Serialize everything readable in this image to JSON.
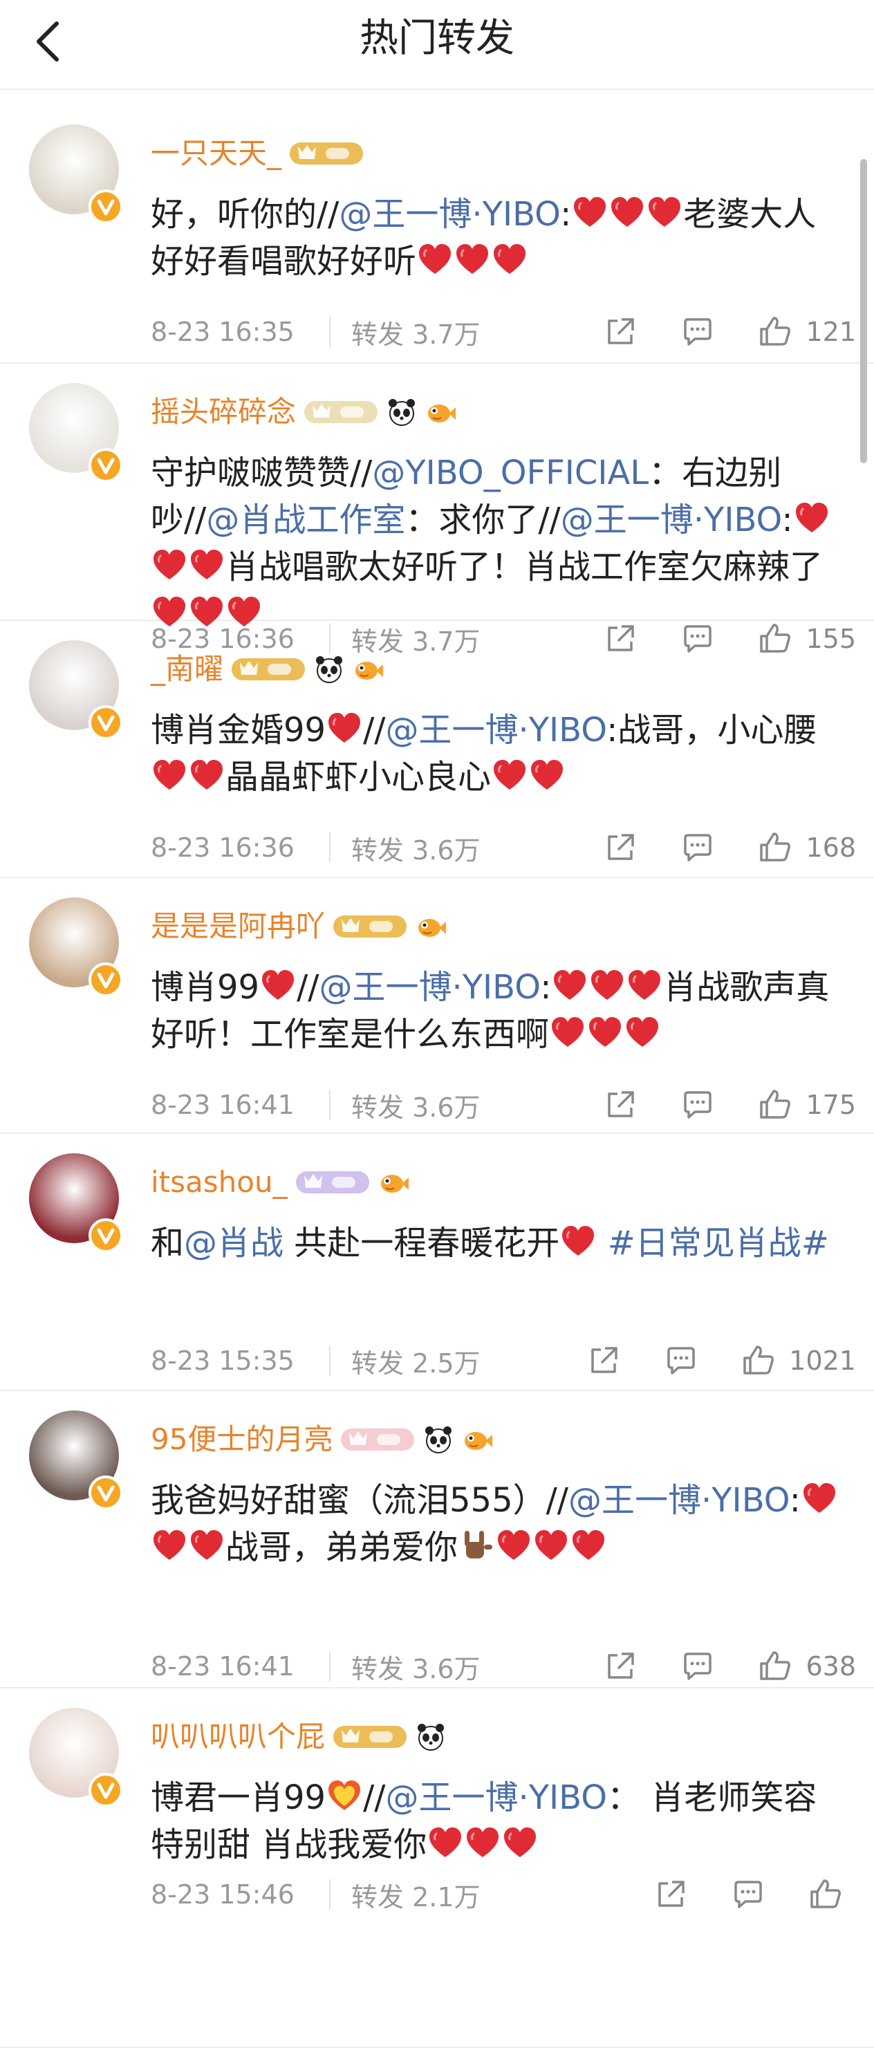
{
  "header": {
    "title": "热门转发"
  },
  "posts": [
    {
      "username": "一只天天_",
      "body": [
        {
          "t": "text",
          "v": "好，听你的//"
        },
        {
          "t": "mention",
          "v": "@王一博·YIBO"
        },
        {
          "t": "text",
          "v": ":"
        },
        {
          "t": "heart"
        },
        {
          "t": "heart"
        },
        {
          "t": "heart"
        },
        {
          "t": "text",
          "v": "老婆大人好好看唱歌好好听"
        },
        {
          "t": "heart"
        },
        {
          "t": "heart"
        },
        {
          "t": "heart"
        }
      ],
      "time": "8-23 16:35",
      "repost": "转发 3.7万",
      "likes": "121",
      "badge_color": "#e9b23a",
      "avatar_color": "#dcd6c8",
      "emojis": []
    },
    {
      "username": "摇头碎碎念",
      "body": [
        {
          "t": "text",
          "v": "守护啵啵赞赞//"
        },
        {
          "t": "mention",
          "v": "@YIBO_OFFICIAL"
        },
        {
          "t": "text",
          "v": "：右边别吵//"
        },
        {
          "t": "mention",
          "v": "@肖战工作室"
        },
        {
          "t": "text",
          "v": "：求你了//"
        },
        {
          "t": "mention",
          "v": "@王一博·YIBO"
        },
        {
          "t": "text",
          "v": ":"
        },
        {
          "t": "heart"
        },
        {
          "t": "heart"
        },
        {
          "t": "heart"
        },
        {
          "t": "text",
          "v": "肖战唱歌太好听了！肖战工作室欠麻辣了"
        },
        {
          "t": "heart"
        },
        {
          "t": "heart"
        },
        {
          "t": "heart"
        }
      ],
      "time": "8-23 16:36",
      "repost": "转发 3.7万",
      "likes": "155",
      "badge_color": "#e8d9a8",
      "avatar_color": "#e6e2dc",
      "emojis": [
        "panda",
        "fish"
      ]
    },
    {
      "username": "_南曜",
      "body": [
        {
          "t": "text",
          "v": "博肖金婚99"
        },
        {
          "t": "heart"
        },
        {
          "t": "text",
          "v": "//"
        },
        {
          "t": "mention",
          "v": "@王一博·YIBO"
        },
        {
          "t": "text",
          "v": ":战哥，小心腰"
        },
        {
          "t": "heart"
        },
        {
          "t": "heart"
        },
        {
          "t": "text",
          "v": "晶晶虾虾小心良心"
        },
        {
          "t": "heart"
        },
        {
          "t": "heart"
        }
      ],
      "time": "8-23 16:36",
      "repost": "转发 3.6万",
      "likes": "168",
      "badge_color": "#e9b23a",
      "avatar_color": "#d9d3cf",
      "emojis": [
        "panda",
        "fish"
      ]
    },
    {
      "username": "是是是阿冉吖",
      "body": [
        {
          "t": "text",
          "v": "博肖99"
        },
        {
          "t": "heart"
        },
        {
          "t": "text",
          "v": "//"
        },
        {
          "t": "mention",
          "v": "@王一博·YIBO"
        },
        {
          "t": "text",
          "v": ":"
        },
        {
          "t": "heart"
        },
        {
          "t": "heart"
        },
        {
          "t": "heart"
        },
        {
          "t": "text",
          "v": "肖战歌声真好听！工作室是什么东西啊"
        },
        {
          "t": "heart"
        },
        {
          "t": "heart"
        },
        {
          "t": "heart"
        }
      ],
      "time": "8-23 16:41",
      "repost": "转发 3.6万",
      "likes": "175",
      "badge_color": "#e9b23a",
      "avatar_color": "#c9a98a",
      "emojis": [
        "fish"
      ]
    },
    {
      "username": "itsashou_",
      "body": [
        {
          "t": "text",
          "v": "和"
        },
        {
          "t": "mention",
          "v": "@肖战"
        },
        {
          "t": "text",
          "v": " 共赴一程春暖花开"
        },
        {
          "t": "heart"
        },
        {
          "t": "text",
          "v": " "
        },
        {
          "t": "mention",
          "v": "#日常见肖战#"
        }
      ],
      "time": "8-23 15:35",
      "repost": "转发 2.5万",
      "likes": "1021",
      "badge_color": "#c9b6ea",
      "avatar_color": "#8e2b33",
      "emojis": [
        "fish"
      ]
    },
    {
      "username": "95便士的月亮",
      "body": [
        {
          "t": "text",
          "v": "我爸妈好甜蜜（流泪555）//"
        },
        {
          "t": "mention",
          "v": "@王一博·YIBO"
        },
        {
          "t": "text",
          "v": ":"
        },
        {
          "t": "heart"
        },
        {
          "t": "heart"
        },
        {
          "t": "heart"
        },
        {
          "t": "text",
          "v": "战哥，弟弟爱你"
        },
        {
          "t": "rock"
        },
        {
          "t": "heart"
        },
        {
          "t": "heart"
        },
        {
          "t": "heart"
        }
      ],
      "time": "8-23 16:41",
      "repost": "转发 3.6万",
      "likes": "638",
      "badge_color": "#f2c3c9",
      "avatar_color": "#6d5a52",
      "emojis": [
        "panda",
        "fish"
      ]
    },
    {
      "username": "叭叭叭叭个屁",
      "body": [
        {
          "t": "text",
          "v": "博君一肖99"
        },
        {
          "t": "heart2"
        },
        {
          "t": "text",
          "v": "//"
        },
        {
          "t": "mention",
          "v": "@王一博·YIBO"
        },
        {
          "t": "text",
          "v": "： 肖老师笑容特别甜 肖战我爱你"
        },
        {
          "t": "heart"
        },
        {
          "t": "heart"
        },
        {
          "t": "heart"
        }
      ],
      "time": "8-23 15:46",
      "repost": "转发 2.1万",
      "likes": "",
      "badge_color": "#e9b23a",
      "avatar_color": "#e7d6cf",
      "emojis": [
        "panda"
      ]
    }
  ],
  "colors": {
    "username": "#e8832a",
    "mention": "#4a6ea8",
    "heart": "#e02b35",
    "meta": "#999999"
  },
  "icons": [
    "back-icon",
    "share-icon",
    "comment-icon",
    "like-icon",
    "verified-icon",
    "panda-emoji",
    "fish-emoji"
  ]
}
